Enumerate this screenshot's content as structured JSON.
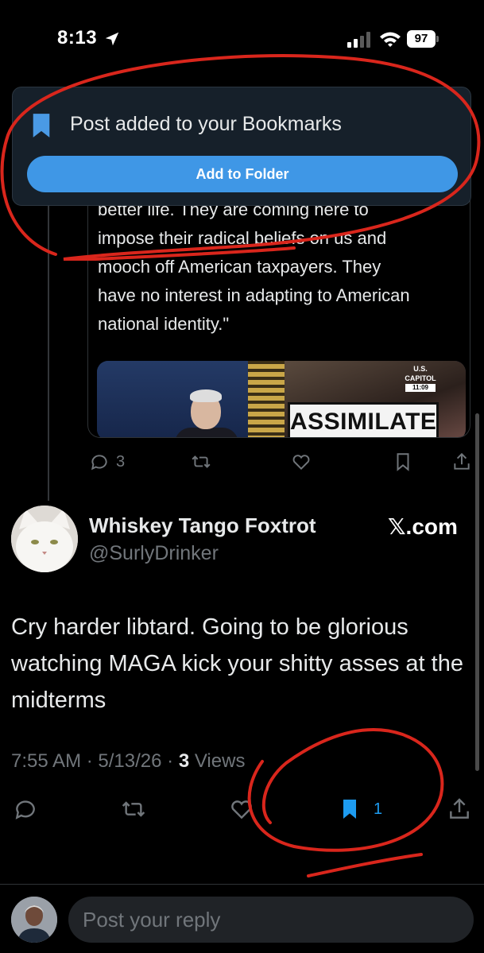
{
  "status_bar": {
    "time": "8:13",
    "battery": "97",
    "icons": [
      "location-arrow-icon",
      "signal-icon",
      "wifi-icon",
      "battery-icon"
    ]
  },
  "toast": {
    "message": "Post added to your Bookmarks",
    "button_label": "Add to Folder",
    "icon": "bookmark-icon",
    "accent": "#3f97e6"
  },
  "quoted_post": {
    "lines": [
      "better life. They are coming here to",
      "impose their radical beliefs on us and",
      "mooch off American taxpayers. They",
      "have no interest in adapting to American",
      "national identity.\""
    ],
    "media": {
      "banner_text": "ASSIMILATE",
      "bug_line1": "U.S. CAPITOL",
      "bug_line2": "11:09"
    },
    "actions": {
      "reply_count": "3"
    }
  },
  "tweet": {
    "author_name": "Whiskey Tango Foxtrot",
    "author_handle": "@SurlyDrinker",
    "source_label": "𝕏.com",
    "text": "Cry harder libtard.  Going to be glorious watching MAGA kick your shitty asses at the midterms",
    "time": "7:55 AM",
    "date": "5/13/26",
    "views_count": "3",
    "views_label": "Views",
    "sep": "·",
    "bookmark_count": "1"
  },
  "reply": {
    "placeholder": "Post your reply"
  },
  "colors": {
    "background": "#000000",
    "accent": "#1d9bf0",
    "muted": "#71767b",
    "annotation": "#d9261c"
  }
}
